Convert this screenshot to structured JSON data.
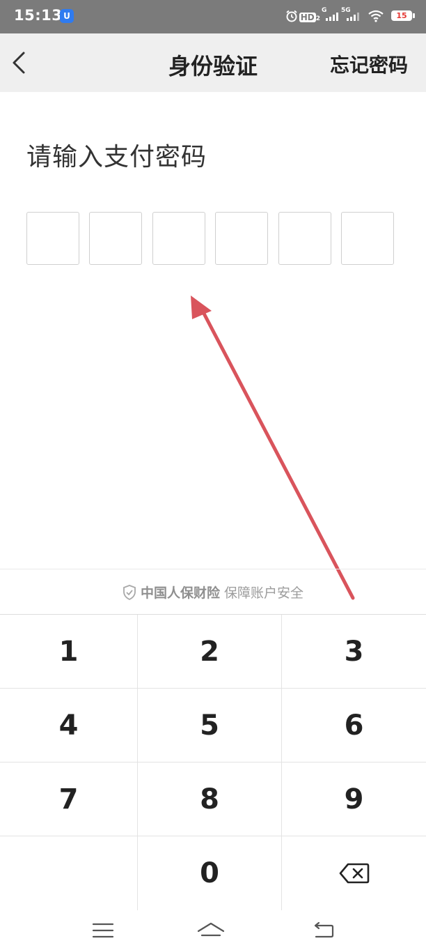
{
  "status_bar": {
    "time": "15:13",
    "app_badge": "U",
    "hd_label": "HD",
    "hd_sub": "2",
    "signal1_label": "G",
    "signal2_label": "5G",
    "battery_level": "15",
    "icons": [
      "alarm-icon",
      "hd-icon",
      "signal-icon",
      "signal-5g-icon",
      "wifi-icon",
      "battery-icon"
    ]
  },
  "nav": {
    "title": "身份验证",
    "forgot_label": "忘记密码",
    "back_icon": "chevron-left-icon"
  },
  "content": {
    "prompt": "请输入支付密码",
    "pin_length": 6
  },
  "security": {
    "brand": "中国人保财险",
    "text": "保障账户安全",
    "icon": "shield-check-icon"
  },
  "keypad": {
    "rows": [
      [
        "1",
        "2",
        "3"
      ],
      [
        "4",
        "5",
        "6"
      ],
      [
        "7",
        "8",
        "9"
      ],
      [
        "",
        "0",
        "backspace"
      ]
    ]
  },
  "system_nav": [
    "menu-icon",
    "home-icon",
    "back-icon"
  ],
  "colors": {
    "status_bar_bg": "#7b7b7b",
    "nav_bg": "#efefef",
    "arrow": "#d9545c",
    "muted_text": "#9c9c9c",
    "battery_low": "#e53935"
  }
}
